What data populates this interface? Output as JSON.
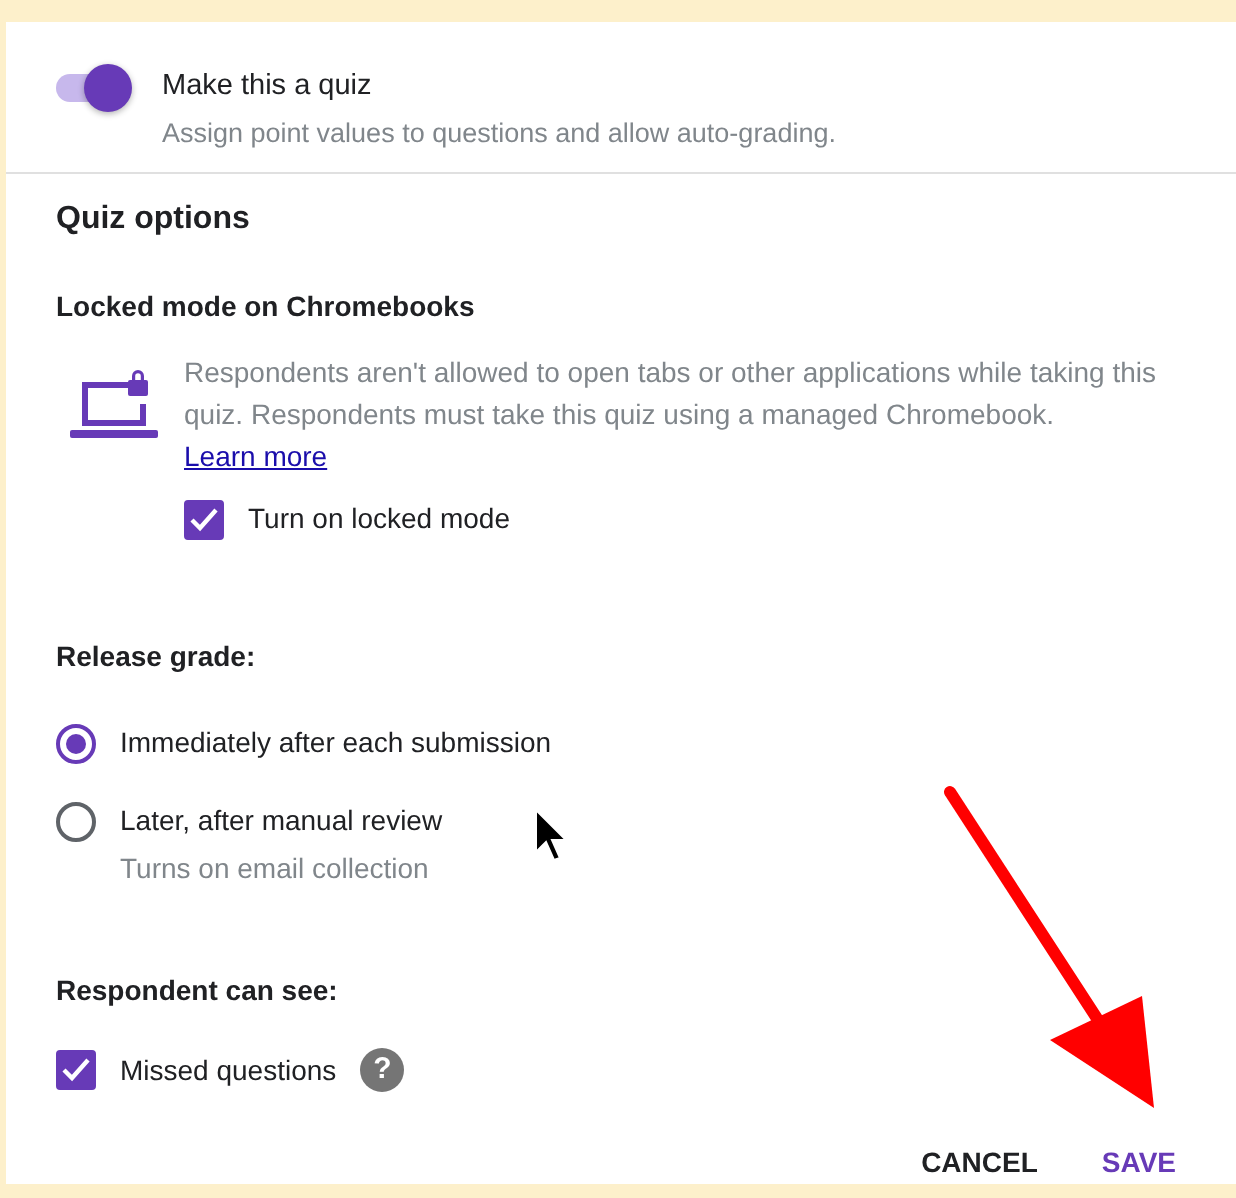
{
  "quiz_toggle": {
    "label": "Make this a quiz",
    "description": "Assign point values to questions and allow auto-grading.",
    "on": true
  },
  "section_title": "Quiz options",
  "locked_mode": {
    "heading": "Locked mode on Chromebooks",
    "description": "Respondents aren't allowed to open tabs or other applications while taking this quiz. Respondents must take this quiz using a managed Chromebook.",
    "link": "Learn more",
    "checkbox": {
      "label": "Turn on locked mode",
      "checked": true
    }
  },
  "release_grade": {
    "heading": "Release grade:",
    "options": [
      {
        "label": "Immediately after each submission",
        "selected": true
      },
      {
        "label": "Later, after manual review",
        "hint": "Turns on email collection",
        "selected": false
      }
    ]
  },
  "respondent_can_see": {
    "heading": "Respondent can see:",
    "items": [
      {
        "label": "Missed questions",
        "checked": true,
        "help": "?"
      }
    ]
  },
  "buttons": [
    {
      "label": "CANCEL",
      "kind": "plain"
    },
    {
      "label": "SAVE",
      "kind": "primary"
    }
  ]
}
